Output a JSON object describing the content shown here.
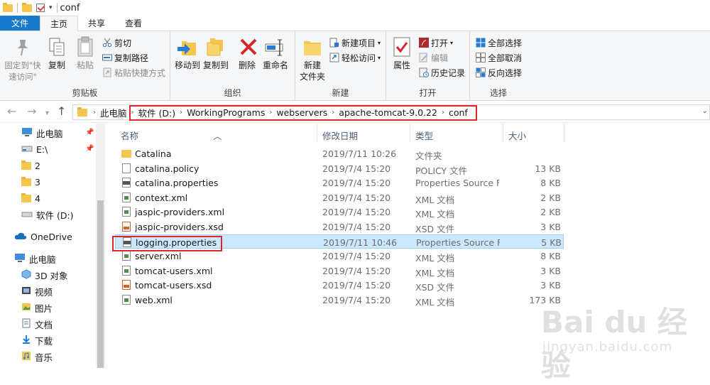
{
  "window": {
    "title": "conf"
  },
  "tabs": [
    {
      "label": "文件"
    },
    {
      "label": "主页"
    },
    {
      "label": "共享"
    },
    {
      "label": "查看"
    }
  ],
  "ribbon": {
    "clipboard": {
      "label": "剪贴板",
      "pin": "固定到\"快速访问\"",
      "copy": "复制",
      "paste": "粘贴",
      "cut": "剪切",
      "copy_path": "复制路径",
      "paste_shortcut": "粘贴快捷方式"
    },
    "organize": {
      "label": "组织",
      "move_to": "移动到",
      "copy_to": "复制到",
      "delete": "删除",
      "rename": "重命名"
    },
    "new": {
      "label": "新建",
      "new_folder": "新建\n文件夹",
      "new_item": "新建项目",
      "easy_access": "轻松访问"
    },
    "open": {
      "label": "打开",
      "properties": "属性",
      "open": "打开",
      "edit": "编辑",
      "history": "历史记录"
    },
    "select": {
      "label": "选择",
      "select_all": "全部选择",
      "select_none": "全部取消",
      "invert": "反向选择"
    }
  },
  "address": {
    "crumbs": [
      "此电脑",
      "软件 (D:)",
      "WorkingPrograms",
      "webservers",
      "apache-tomcat-9.0.22",
      "conf"
    ]
  },
  "nav": {
    "items": [
      {
        "label": "此电脑",
        "icon": "pc-icon",
        "pinned": true
      },
      {
        "label": "E:\\",
        "icon": "drive-icon",
        "pinned": true
      },
      {
        "label": "2",
        "icon": "folder-icon"
      },
      {
        "label": "3",
        "icon": "folder-icon"
      },
      {
        "label": "4",
        "icon": "folder-icon"
      },
      {
        "label": "软件 (D:)",
        "icon": "drive-icon"
      },
      {
        "label": "OneDrive",
        "icon": "cloud-icon"
      },
      {
        "label": "此电脑",
        "icon": "pc-icon"
      },
      {
        "label": "3D 对象",
        "icon": "cube-icon"
      },
      {
        "label": "视频",
        "icon": "video-icon"
      },
      {
        "label": "图片",
        "icon": "image-icon"
      },
      {
        "label": "文档",
        "icon": "document-icon"
      },
      {
        "label": "下载",
        "icon": "download-icon"
      },
      {
        "label": "音乐",
        "icon": "music-icon"
      }
    ]
  },
  "columns": {
    "name": "名称",
    "date": "修改日期",
    "type": "类型",
    "size": "大小"
  },
  "files": [
    {
      "name": "Catalina",
      "date": "2019/7/11 10:26",
      "type": "文件夹",
      "size": "",
      "kind": "folder"
    },
    {
      "name": "catalina.policy",
      "date": "2019/7/4 15:20",
      "type": "POLICY 文件",
      "size": "13 KB",
      "kind": "file"
    },
    {
      "name": "catalina.properties",
      "date": "2019/7/4 15:20",
      "type": "Properties Source F...",
      "size": "8 KB",
      "kind": "prop"
    },
    {
      "name": "context.xml",
      "date": "2019/7/4 15:20",
      "type": "XML 文档",
      "size": "2 KB",
      "kind": "xml"
    },
    {
      "name": "jaspic-providers.xml",
      "date": "2019/7/4 15:20",
      "type": "XML 文档",
      "size": "2 KB",
      "kind": "xml"
    },
    {
      "name": "jaspic-providers.xsd",
      "date": "2019/7/4 15:20",
      "type": "XSD 文件",
      "size": "3 KB",
      "kind": "xsd"
    },
    {
      "name": "logging.properties",
      "date": "2019/7/11 10:46",
      "type": "Properties Source F...",
      "size": "5 KB",
      "kind": "prop",
      "selected": true
    },
    {
      "name": "server.xml",
      "date": "2019/7/4 15:20",
      "type": "XML 文档",
      "size": "8 KB",
      "kind": "xml"
    },
    {
      "name": "tomcat-users.xml",
      "date": "2019/7/4 15:20",
      "type": "XML 文档",
      "size": "3 KB",
      "kind": "xml"
    },
    {
      "name": "tomcat-users.xsd",
      "date": "2019/7/4 15:20",
      "type": "XSD 文件",
      "size": "3 KB",
      "kind": "xsd"
    },
    {
      "name": "web.xml",
      "date": "2019/7/4 15:20",
      "type": "XML 文档",
      "size": "173 KB",
      "kind": "xml"
    }
  ],
  "watermark": {
    "main": "Bai du 经验",
    "sub": "jingyan.baidu.com"
  },
  "colors": {
    "accent": "#1979ca",
    "selection": "#cce8ff",
    "highlight_box": "#e0262d"
  }
}
